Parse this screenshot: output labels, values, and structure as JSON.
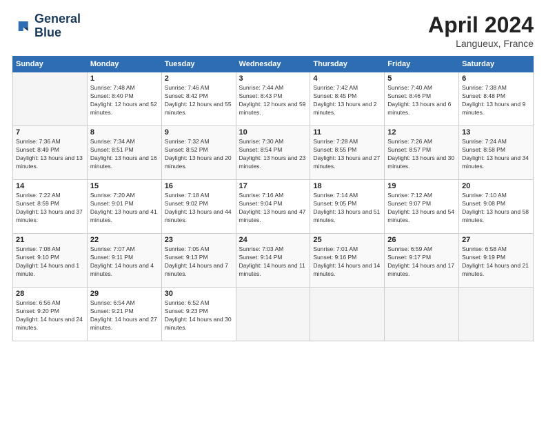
{
  "header": {
    "logo_line1": "General",
    "logo_line2": "Blue",
    "month_title": "April 2024",
    "location": "Langueux, France"
  },
  "weekdays": [
    "Sunday",
    "Monday",
    "Tuesday",
    "Wednesday",
    "Thursday",
    "Friday",
    "Saturday"
  ],
  "weeks": [
    [
      {
        "num": "",
        "sunrise": "",
        "sunset": "",
        "daylight": "",
        "empty": true
      },
      {
        "num": "1",
        "sunrise": "Sunrise: 7:48 AM",
        "sunset": "Sunset: 8:40 PM",
        "daylight": "Daylight: 12 hours and 52 minutes."
      },
      {
        "num": "2",
        "sunrise": "Sunrise: 7:46 AM",
        "sunset": "Sunset: 8:42 PM",
        "daylight": "Daylight: 12 hours and 55 minutes."
      },
      {
        "num": "3",
        "sunrise": "Sunrise: 7:44 AM",
        "sunset": "Sunset: 8:43 PM",
        "daylight": "Daylight: 12 hours and 59 minutes."
      },
      {
        "num": "4",
        "sunrise": "Sunrise: 7:42 AM",
        "sunset": "Sunset: 8:45 PM",
        "daylight": "Daylight: 13 hours and 2 minutes."
      },
      {
        "num": "5",
        "sunrise": "Sunrise: 7:40 AM",
        "sunset": "Sunset: 8:46 PM",
        "daylight": "Daylight: 13 hours and 6 minutes."
      },
      {
        "num": "6",
        "sunrise": "Sunrise: 7:38 AM",
        "sunset": "Sunset: 8:48 PM",
        "daylight": "Daylight: 13 hours and 9 minutes."
      }
    ],
    [
      {
        "num": "7",
        "sunrise": "Sunrise: 7:36 AM",
        "sunset": "Sunset: 8:49 PM",
        "daylight": "Daylight: 13 hours and 13 minutes."
      },
      {
        "num": "8",
        "sunrise": "Sunrise: 7:34 AM",
        "sunset": "Sunset: 8:51 PM",
        "daylight": "Daylight: 13 hours and 16 minutes."
      },
      {
        "num": "9",
        "sunrise": "Sunrise: 7:32 AM",
        "sunset": "Sunset: 8:52 PM",
        "daylight": "Daylight: 13 hours and 20 minutes."
      },
      {
        "num": "10",
        "sunrise": "Sunrise: 7:30 AM",
        "sunset": "Sunset: 8:54 PM",
        "daylight": "Daylight: 13 hours and 23 minutes."
      },
      {
        "num": "11",
        "sunrise": "Sunrise: 7:28 AM",
        "sunset": "Sunset: 8:55 PM",
        "daylight": "Daylight: 13 hours and 27 minutes."
      },
      {
        "num": "12",
        "sunrise": "Sunrise: 7:26 AM",
        "sunset": "Sunset: 8:57 PM",
        "daylight": "Daylight: 13 hours and 30 minutes."
      },
      {
        "num": "13",
        "sunrise": "Sunrise: 7:24 AM",
        "sunset": "Sunset: 8:58 PM",
        "daylight": "Daylight: 13 hours and 34 minutes."
      }
    ],
    [
      {
        "num": "14",
        "sunrise": "Sunrise: 7:22 AM",
        "sunset": "Sunset: 8:59 PM",
        "daylight": "Daylight: 13 hours and 37 minutes."
      },
      {
        "num": "15",
        "sunrise": "Sunrise: 7:20 AM",
        "sunset": "Sunset: 9:01 PM",
        "daylight": "Daylight: 13 hours and 41 minutes."
      },
      {
        "num": "16",
        "sunrise": "Sunrise: 7:18 AM",
        "sunset": "Sunset: 9:02 PM",
        "daylight": "Daylight: 13 hours and 44 minutes."
      },
      {
        "num": "17",
        "sunrise": "Sunrise: 7:16 AM",
        "sunset": "Sunset: 9:04 PM",
        "daylight": "Daylight: 13 hours and 47 minutes."
      },
      {
        "num": "18",
        "sunrise": "Sunrise: 7:14 AM",
        "sunset": "Sunset: 9:05 PM",
        "daylight": "Daylight: 13 hours and 51 minutes."
      },
      {
        "num": "19",
        "sunrise": "Sunrise: 7:12 AM",
        "sunset": "Sunset: 9:07 PM",
        "daylight": "Daylight: 13 hours and 54 minutes."
      },
      {
        "num": "20",
        "sunrise": "Sunrise: 7:10 AM",
        "sunset": "Sunset: 9:08 PM",
        "daylight": "Daylight: 13 hours and 58 minutes."
      }
    ],
    [
      {
        "num": "21",
        "sunrise": "Sunrise: 7:08 AM",
        "sunset": "Sunset: 9:10 PM",
        "daylight": "Daylight: 14 hours and 1 minute."
      },
      {
        "num": "22",
        "sunrise": "Sunrise: 7:07 AM",
        "sunset": "Sunset: 9:11 PM",
        "daylight": "Daylight: 14 hours and 4 minutes."
      },
      {
        "num": "23",
        "sunrise": "Sunrise: 7:05 AM",
        "sunset": "Sunset: 9:13 PM",
        "daylight": "Daylight: 14 hours and 7 minutes."
      },
      {
        "num": "24",
        "sunrise": "Sunrise: 7:03 AM",
        "sunset": "Sunset: 9:14 PM",
        "daylight": "Daylight: 14 hours and 11 minutes."
      },
      {
        "num": "25",
        "sunrise": "Sunrise: 7:01 AM",
        "sunset": "Sunset: 9:16 PM",
        "daylight": "Daylight: 14 hours and 14 minutes."
      },
      {
        "num": "26",
        "sunrise": "Sunrise: 6:59 AM",
        "sunset": "Sunset: 9:17 PM",
        "daylight": "Daylight: 14 hours and 17 minutes."
      },
      {
        "num": "27",
        "sunrise": "Sunrise: 6:58 AM",
        "sunset": "Sunset: 9:19 PM",
        "daylight": "Daylight: 14 hours and 21 minutes."
      }
    ],
    [
      {
        "num": "28",
        "sunrise": "Sunrise: 6:56 AM",
        "sunset": "Sunset: 9:20 PM",
        "daylight": "Daylight: 14 hours and 24 minutes."
      },
      {
        "num": "29",
        "sunrise": "Sunrise: 6:54 AM",
        "sunset": "Sunset: 9:21 PM",
        "daylight": "Daylight: 14 hours and 27 minutes."
      },
      {
        "num": "30",
        "sunrise": "Sunrise: 6:52 AM",
        "sunset": "Sunset: 9:23 PM",
        "daylight": "Daylight: 14 hours and 30 minutes."
      },
      {
        "num": "",
        "sunrise": "",
        "sunset": "",
        "daylight": "",
        "empty": true
      },
      {
        "num": "",
        "sunrise": "",
        "sunset": "",
        "daylight": "",
        "empty": true
      },
      {
        "num": "",
        "sunrise": "",
        "sunset": "",
        "daylight": "",
        "empty": true
      },
      {
        "num": "",
        "sunrise": "",
        "sunset": "",
        "daylight": "",
        "empty": true
      }
    ]
  ]
}
